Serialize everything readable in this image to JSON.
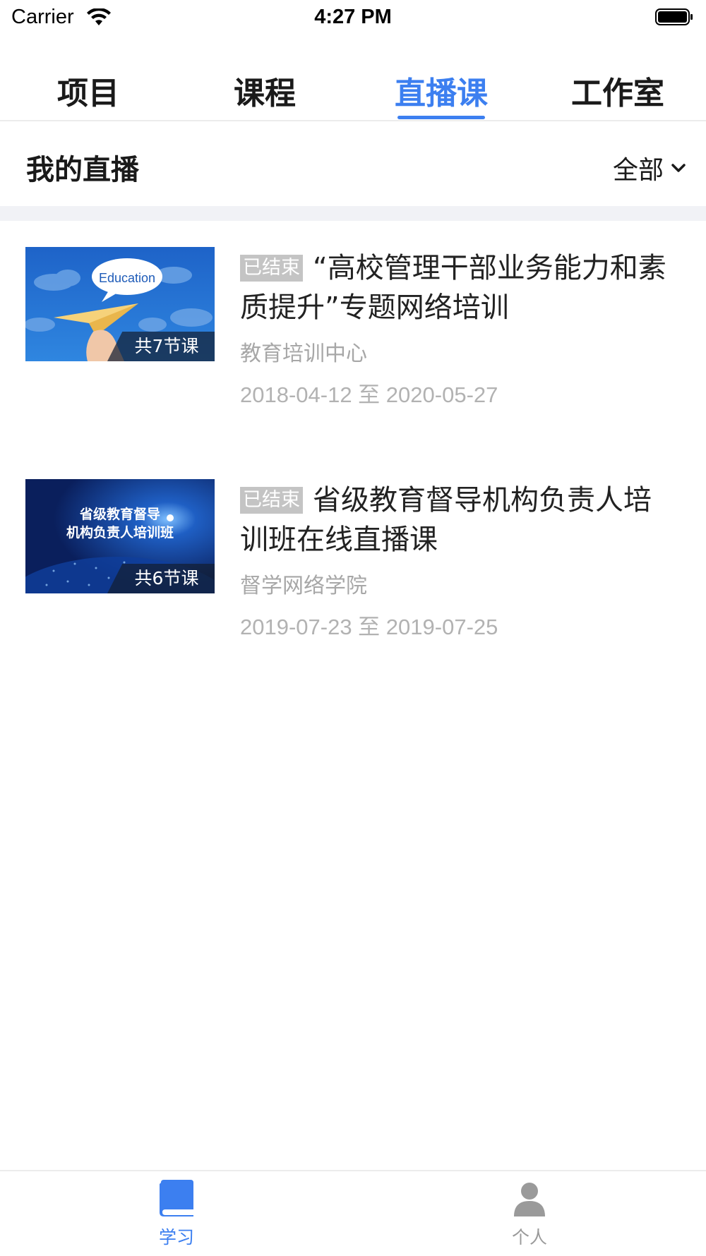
{
  "status_bar": {
    "carrier": "Carrier",
    "time": "4:27 PM"
  },
  "tabs": [
    {
      "label": "项目",
      "active": false
    },
    {
      "label": "课程",
      "active": false
    },
    {
      "label": "直播课",
      "active": true
    },
    {
      "label": "工作室",
      "active": false
    }
  ],
  "section": {
    "title": "我的直播",
    "filter_label": "全部"
  },
  "live_courses": [
    {
      "thumbnail_text": "Education",
      "lesson_count": "共7节课",
      "status": "已结束",
      "title": "“高校管理干部业务能力和素质提升”专题网络培训",
      "organization": "教育培训中心",
      "dates": "2018-04-12 至 2020-05-27"
    },
    {
      "thumbnail_text_lines": [
        "省级教育督导",
        "机构负责人培训班"
      ],
      "lesson_count": "共6节课",
      "status": "已结束",
      "title": "省级教育督导机构负责人培训班在线直播课",
      "organization": "督学网络学院",
      "dates": "2019-07-23 至 2019-07-25"
    }
  ],
  "bottom_tabs": [
    {
      "label": "学习",
      "icon": "book-icon",
      "active": true
    },
    {
      "label": "个人",
      "icon": "person-icon",
      "active": false
    }
  ],
  "colors": {
    "accent": "#3c7ff0",
    "badge_bg": "#c4c4c4",
    "muted_text": "#a7a7a7",
    "divider_band": "#f1f2f6"
  }
}
